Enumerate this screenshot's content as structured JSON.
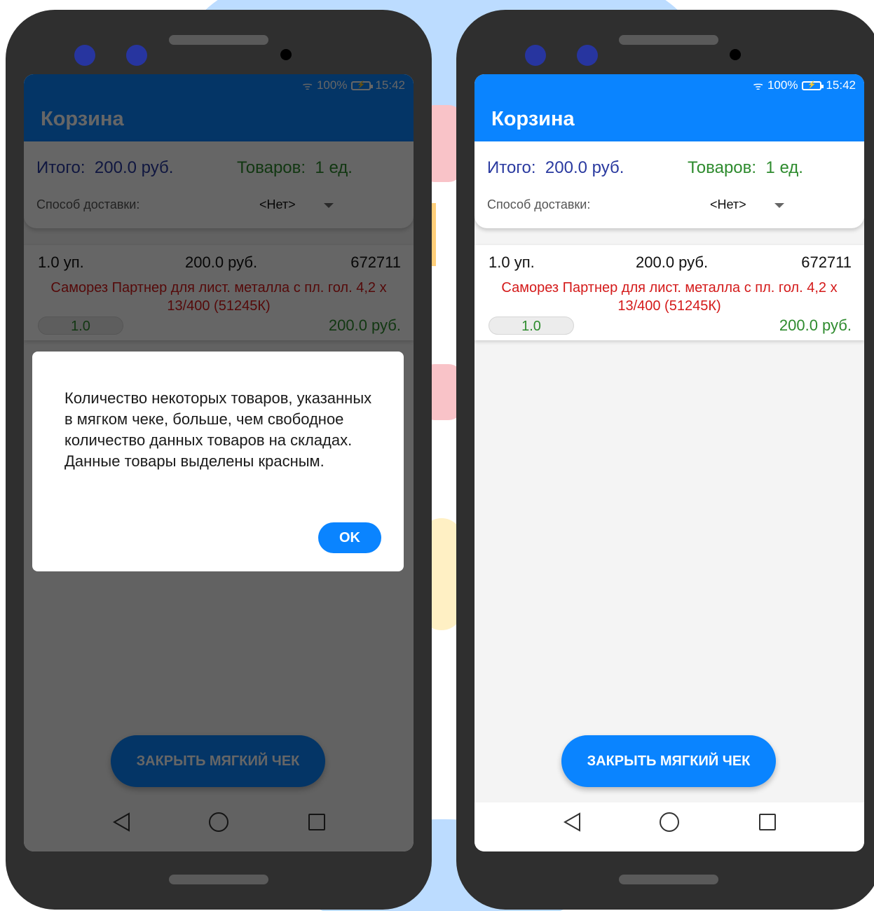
{
  "status_bar": {
    "battery": "100%",
    "time": "15:42"
  },
  "app_bar": {
    "title": "Корзина"
  },
  "summary": {
    "total_label": "Итого:",
    "total_value": "200.0 руб.",
    "items_label": "Товаров:",
    "items_value": "1 ед.",
    "delivery_label": "Способ доставки:",
    "delivery_value": "<Нет>"
  },
  "cart_item": {
    "quantity_unit": "1.0 уп.",
    "price": "200.0 руб.",
    "code": "672711",
    "name": "Саморез Партнер для лист. металла с пл. гол. 4,2 х 13/400 (51245К)",
    "quantity_input": "1.0",
    "sum": "200.0 руб."
  },
  "close_button_label": "ЗАКРЫТЬ МЯГКИЙ ЧЕК",
  "dialog": {
    "message": "Количество некоторых товаров, указанных в мягком чеке, больше, чем свободное количество данных товаров на складах. Данные товары выделены красным.",
    "ok_label": "OK"
  },
  "colors": {
    "app_bar_dimmed": "#013271",
    "app_bar_active": "#0a84ff",
    "accent_button": "#0a84ff",
    "total_text": "#2a3aa0",
    "count_text": "#2e8b2e",
    "warning_text": "#d41a1a",
    "phone_body": "#2f2f2f"
  }
}
